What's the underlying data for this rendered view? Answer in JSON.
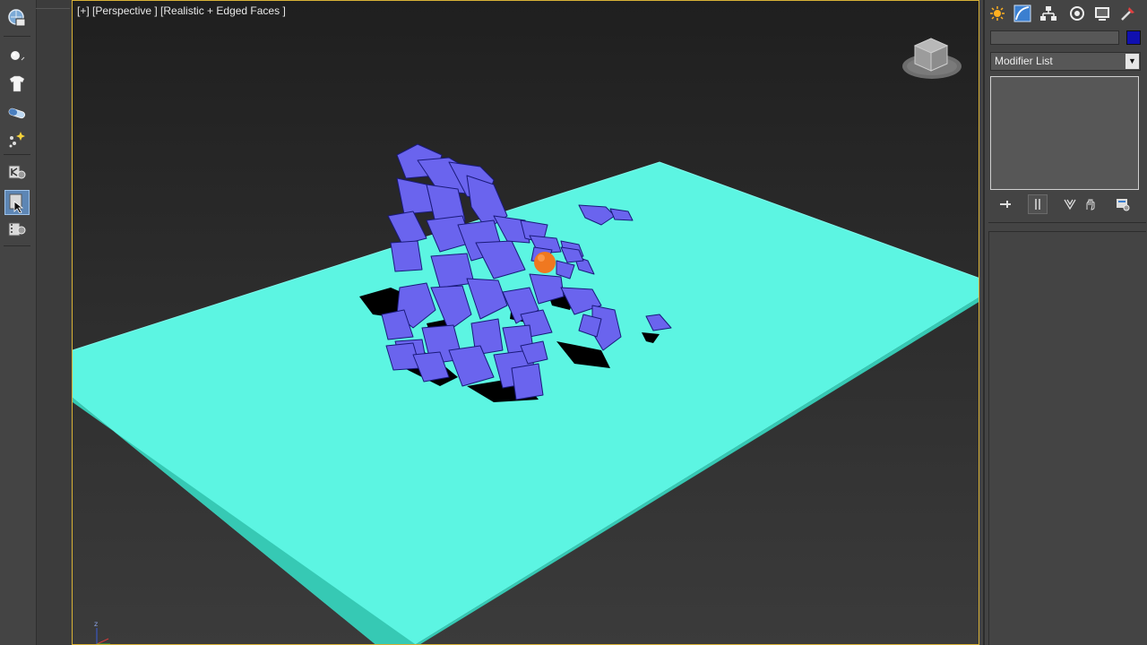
{
  "viewport": {
    "label": "[+] [Perspective ] [Realistic + Edged Faces ]",
    "axis_tripod_label": "z",
    "colors": {
      "ground": "#5cf5e2",
      "fragments": "#6a64ee",
      "sphere": "#f07820",
      "active_border": "#d8b136"
    }
  },
  "left_toolbar": {
    "tools": [
      {
        "icon": "globe-refresh-icon",
        "active": false
      },
      {
        "icon": "sphere-object-icon",
        "active": false
      },
      {
        "icon": "tshirt-cloth-icon",
        "active": false
      },
      {
        "icon": "pill-capsule-icon",
        "active": false
      },
      {
        "icon": "particle-sparkle-icon",
        "active": false
      },
      {
        "icon": "animation-settings-icon",
        "active": false
      },
      {
        "icon": "select-cursor-icon",
        "active": true
      },
      {
        "icon": "film-settings-icon",
        "active": false
      }
    ]
  },
  "command_panel": {
    "tabs": [
      "create-tab-icon",
      "modify-tab-icon",
      "hierarchy-tab-icon",
      "motion-tab-icon",
      "display-tab-icon",
      "utilities-tab-icon"
    ],
    "object_name": "",
    "object_color": "#1010b0",
    "modifier_list_label": "Modifier List",
    "stack_tools": [
      "pin-stack-icon",
      "show-end-result-icon",
      "make-unique-icon",
      "remove-modifier-icon",
      "configure-modifier-sets-icon"
    ]
  }
}
